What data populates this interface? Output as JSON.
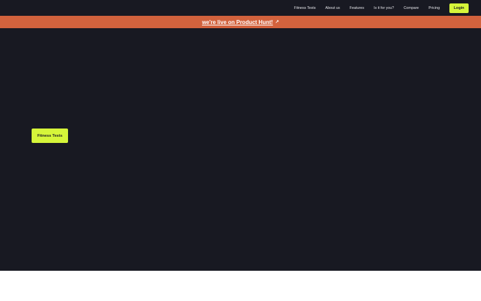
{
  "nav": {
    "items": [
      {
        "label": "Fitness Tests"
      },
      {
        "label": "About us"
      },
      {
        "label": "Features"
      },
      {
        "label": "Is it for you?"
      },
      {
        "label": "Compare"
      },
      {
        "label": "Pricing"
      }
    ],
    "login_label": "Login"
  },
  "banner": {
    "text": "we're live on Product Hunt!",
    "icon": "arrow-icon"
  },
  "hero": {
    "cta_label": "Fitness Tests"
  },
  "colors": {
    "background": "#181922",
    "banner": "#d2623d",
    "accent": "#d6f53a",
    "footer": "#ffffff"
  }
}
